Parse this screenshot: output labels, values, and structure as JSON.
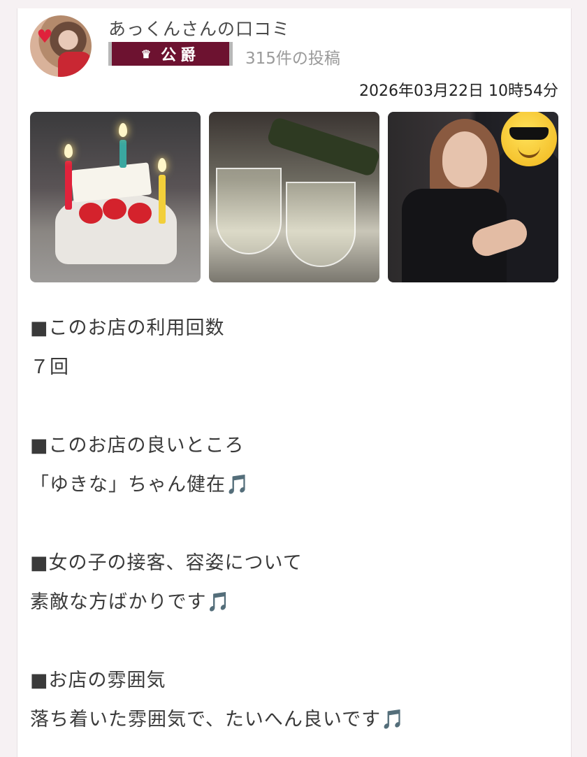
{
  "review": {
    "author_title": "あっくんさんの口コミ",
    "rank": {
      "icon": "crown-icon",
      "label": "公爵",
      "color": "#6d1230"
    },
    "post_count": "315件の投稿",
    "datetime": "2026年03月22日 10時54分"
  },
  "photos": [
    {
      "subject": "birthday-cake-photo"
    },
    {
      "subject": "wine-glasses-photo"
    },
    {
      "subject": "couple-selfie-photo"
    }
  ],
  "sections": [
    {
      "heading": "■このお店の利用回数",
      "answer": "７回"
    },
    {
      "heading": "■このお店の良いところ",
      "answer": "「ゆきな」ちゃん健在🎵"
    },
    {
      "heading": "■女の子の接客、容姿について",
      "answer": "素敵な方ばかりです🎵"
    },
    {
      "heading": "■お店の雰囲気",
      "answer": "落ち着いた雰囲気で、たいへん良いです🎵"
    }
  ]
}
